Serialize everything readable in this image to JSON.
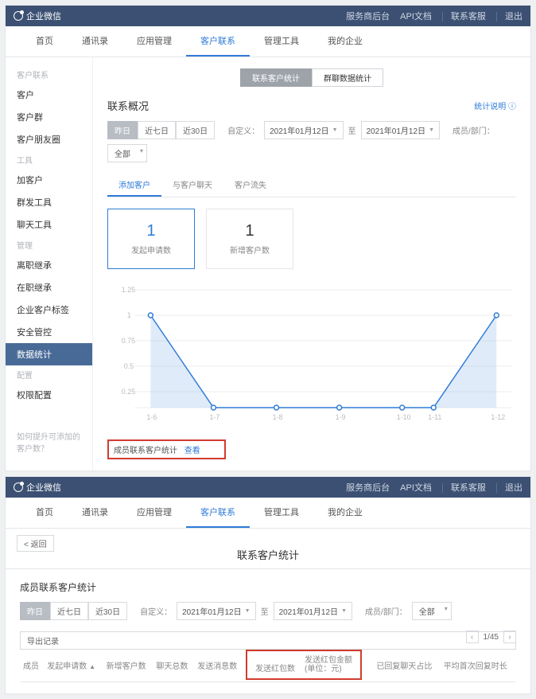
{
  "header": {
    "logo_text": "企业微信",
    "links": [
      "服务商后台",
      "API文档",
      "联系客服",
      "退出"
    ]
  },
  "mainnav": [
    "首页",
    "通讯录",
    "应用管理",
    "客户联系",
    "管理工具",
    "我的企业"
  ],
  "mainnav_active": 3,
  "sidebar": {
    "groups": [
      {
        "title": "客户联系",
        "items": [
          "客户",
          "客户群",
          "客户朋友圈"
        ]
      },
      {
        "title": "工具",
        "items": [
          "加客户",
          "群发工具",
          "聊天工具"
        ]
      },
      {
        "title": "管理",
        "items": [
          "离职继承",
          "在职继承",
          "企业客户标签",
          "安全管控",
          "数据统计"
        ]
      },
      {
        "title": "配置",
        "items": [
          "权限配置"
        ]
      }
    ],
    "active": "数据统计",
    "tip": "如何提升可添加的客户数？"
  },
  "pilltabs": [
    "联系客户统计",
    "群聊数据统计"
  ],
  "overview": {
    "title": "联系概况",
    "help": "统计说明",
    "range_btns": [
      "昨日",
      "近七日",
      "近30日"
    ],
    "range_active": 0,
    "custom_lbl": "自定义：",
    "date_from": "2021年01月12日",
    "to_lbl": "至",
    "date_to": "2021年01月12日",
    "member_lbl": "成员/部门：",
    "member_val": "全部"
  },
  "subtabs": [
    "添加客户",
    "与客户聊天",
    "客户流失"
  ],
  "stats": [
    {
      "num": "1",
      "lbl": "发起申请数"
    },
    {
      "num": "1",
      "lbl": "新增客户数"
    }
  ],
  "footer_link": {
    "text": "成员联系客户统计",
    "action": "查看"
  },
  "panel2": {
    "back": "< 返回",
    "title": "联系客户统计",
    "subtitle": "成员联系客户统计",
    "export": "导出记录",
    "page": "1/45",
    "cols": [
      "成员",
      "发起申请数",
      "新增客户数",
      "聊天总数",
      "发送消息数",
      "发送红包数",
      "发送红包金额\n(单位：元)",
      "已回复聊天占比",
      "平均首次回复时长"
    ]
  },
  "chart_data": {
    "type": "line",
    "x": [
      "1-6",
      "1-7",
      "1-8",
      "1-9",
      "1-10",
      "1-11",
      "1-12"
    ],
    "values": [
      1,
      0,
      0,
      0,
      0,
      0,
      1
    ],
    "ylim": [
      0,
      1.25
    ],
    "yticks": [
      0,
      0.25,
      0.5,
      0.75,
      1,
      1.25
    ]
  }
}
